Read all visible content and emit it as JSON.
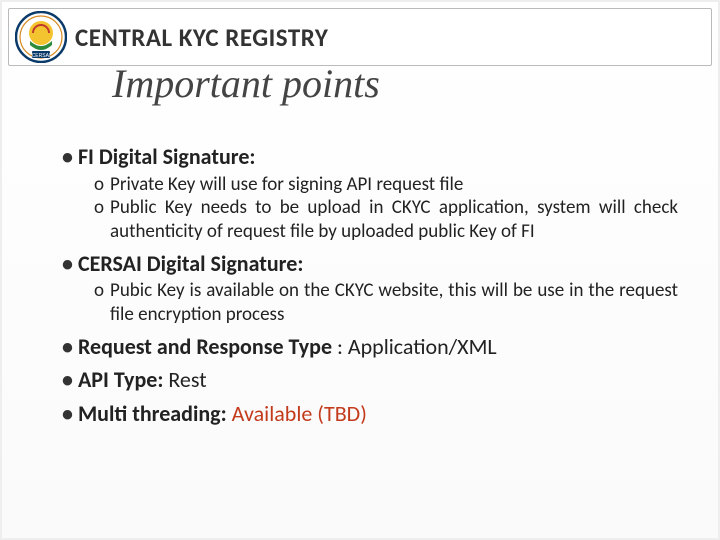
{
  "header": {
    "brand_title": "CENTRAL KYC REGISTRY",
    "logo_label": "CERSAI"
  },
  "page_title": "Important points",
  "bullets": {
    "fi_sig": {
      "heading": "FI Digital Signature:",
      "sub1": "Private Key will use for signing API request file",
      "sub2": "Public Key needs to be upload in CKYC application, system will check authenticity of request file by uploaded public Key of FI"
    },
    "cersai_sig": {
      "heading": "CERSAI Digital Signature:",
      "sub1": "Pubic Key is available on the CKYC website, this will be use in the request file encryption process"
    },
    "req_resp": {
      "strong": "Request and Response Type",
      "rest": " : Application/XML"
    },
    "api": {
      "strong": "API Type: ",
      "rest": "Rest"
    },
    "multi": {
      "strong": "Multi threading: ",
      "rest": "Available  (TBD)"
    }
  }
}
